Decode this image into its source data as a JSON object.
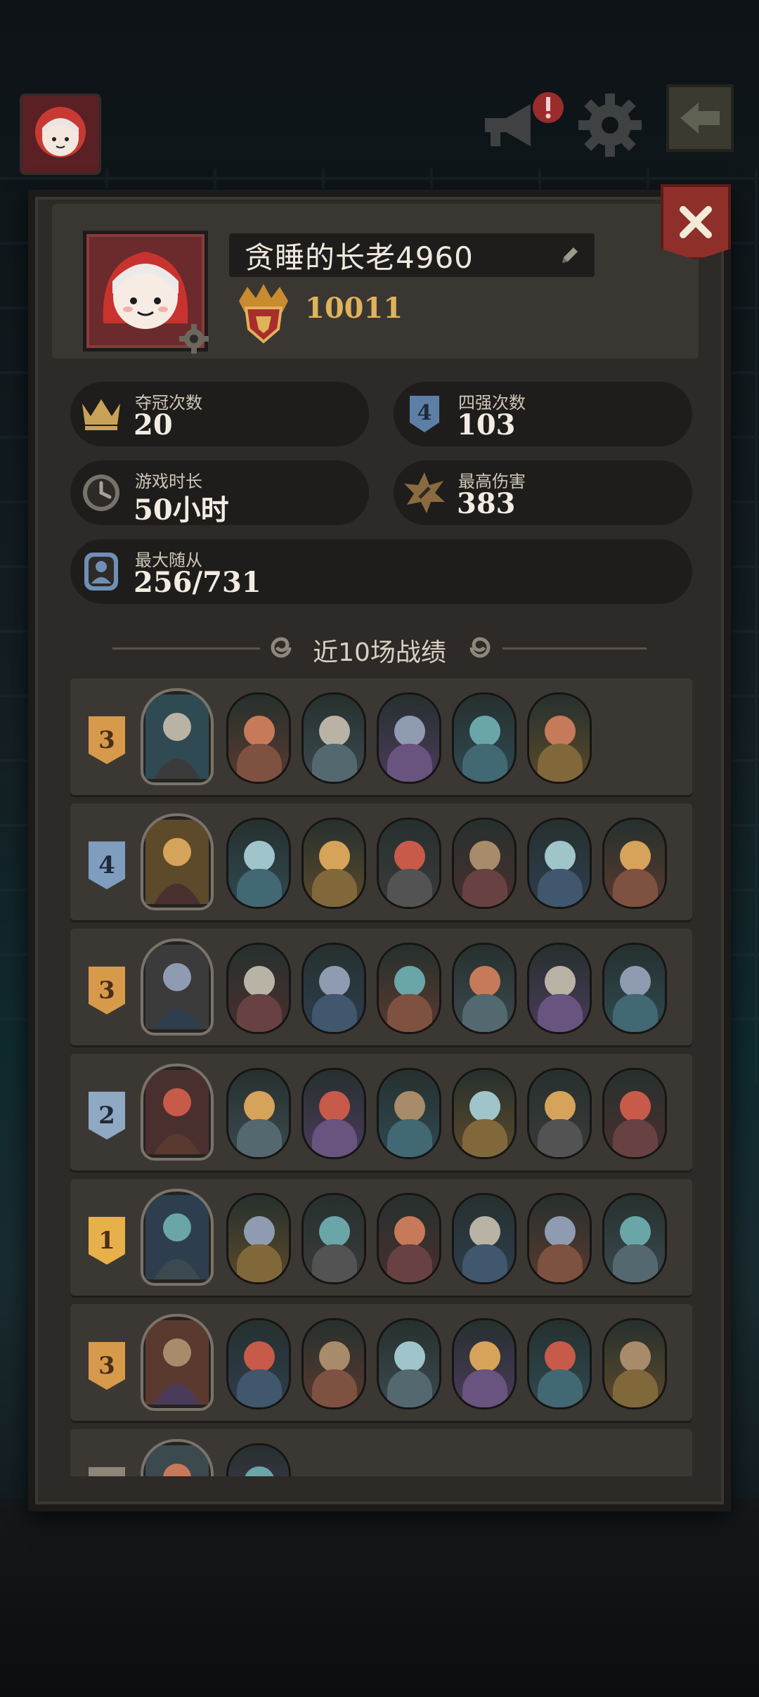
{
  "profile": {
    "name": "贪睡的长老4960",
    "rating": "10011"
  },
  "stats": [
    {
      "id": "champion",
      "label": "夺冠次数",
      "value": "20",
      "icon": "crown-icon"
    },
    {
      "id": "top4",
      "label": "四强次数",
      "value": "103",
      "icon": "top4-shield-icon"
    },
    {
      "id": "playtime",
      "label": "游戏时长",
      "value": "50小时",
      "icon": "clock-icon"
    },
    {
      "id": "maxdamage",
      "label": "最高伤害",
      "value": "383",
      "icon": "burst-icon"
    },
    {
      "id": "maxminions",
      "label": "最大随从",
      "value": "256/731",
      "icon": "minion-portrait-icon"
    }
  ],
  "recent": {
    "title": "近10场战绩",
    "matches": [
      {
        "place": "3",
        "minions": 5
      },
      {
        "place": "4",
        "minions": 6
      },
      {
        "place": "3",
        "minions": 6
      },
      {
        "place": "2",
        "minions": 6
      },
      {
        "place": "1",
        "minions": 6
      },
      {
        "place": "3",
        "minions": 6
      },
      {
        "place": "",
        "minions": 1
      }
    ]
  },
  "colors": {
    "place_1": "#e8b04a",
    "place_2": "#8fa9c4",
    "place_3": "#d79a4a",
    "place_4": "#7e9dbf",
    "panel": "#2d2a27",
    "close": "#8e2f2a"
  },
  "icons": {
    "top_avatar": "player-avatar-icon",
    "announcement": "megaphone-icon",
    "notification": "alert-badge-icon",
    "settings": "gear-icon",
    "exit": "exit-icon",
    "close": "close-icon",
    "edit": "pencil-icon",
    "rank": "rank-crest-icon"
  }
}
